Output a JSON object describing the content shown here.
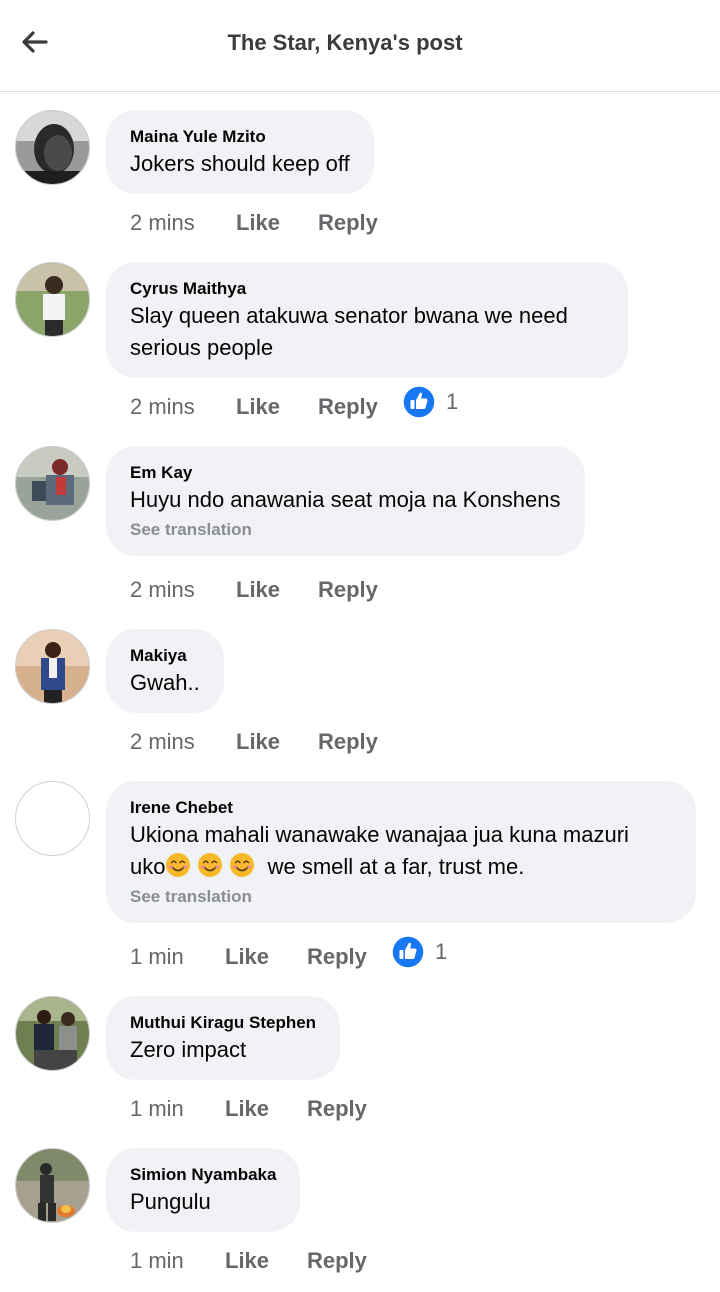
{
  "header": {
    "title": "The Star, Kenya's post",
    "back_icon": "arrow-left-icon"
  },
  "colors": {
    "bubble": "#f0f2f5",
    "meta_text": "#65676b",
    "like_blue": "#1877f2",
    "emoji_yellow": "#f7b928"
  },
  "comments": [
    {
      "author": "Maina Yule Mzito",
      "text": "Jokers should keep off",
      "time": "2 mins",
      "like": "Like",
      "reply": "Reply"
    },
    {
      "author": "Cyrus Maithya",
      "text_line1": "Slay queen atakuwa senator bwana we need",
      "text_line2": "serious people",
      "time": "2 mins",
      "like": "Like",
      "reply": "Reply",
      "reactions": "1"
    },
    {
      "author": "Em Kay",
      "text": "Huyu ndo anawania seat moja na Konshens",
      "see_translation": "See translation",
      "time": "2 mins",
      "like": "Like",
      "reply": "Reply"
    },
    {
      "author": "Makiya",
      "text": "Gwah..",
      "time": "2 mins",
      "like": "Like",
      "reply": "Reply"
    },
    {
      "author": "Irene Chebet",
      "text_line1": "Ukiona mahali wanawake wanajaa jua kuna mazuri",
      "text_line2_prefix": "uko",
      "text_line2_suffix": " we smell at a far, trust me.",
      "emojis": [
        "smiling-face-icon",
        "smiling-face-icon",
        "smiling-face-icon"
      ],
      "see_translation": "See translation",
      "time": "1 min",
      "like": "Like",
      "reply": "Reply",
      "reactions": "1"
    },
    {
      "author": "Muthui Kiragu Stephen",
      "text": "Zero impact",
      "time": "1 min",
      "like": "Like",
      "reply": "Reply"
    },
    {
      "author": "Simion Nyambaka",
      "text": "Pungulu",
      "time": "1 min",
      "like": "Like",
      "reply": "Reply"
    }
  ]
}
